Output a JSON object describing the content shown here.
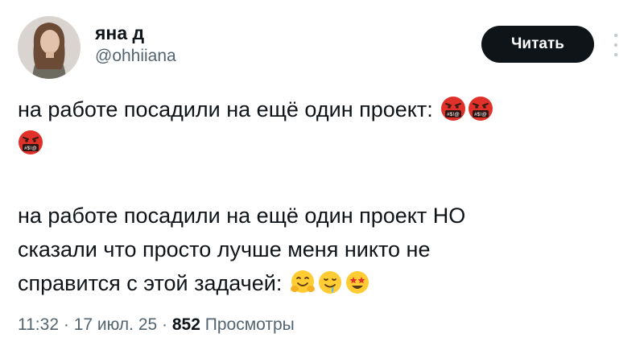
{
  "author": {
    "display_name": "яна д",
    "handle": "@ohhiiana"
  },
  "follow_button": {
    "label": "Читать"
  },
  "tweet": {
    "para1": {
      "line1": "на работе посадили на ещё один проект:",
      "emoji": [
        "face-with-symbols-on-mouth",
        "face-with-symbols-on-mouth",
        "face-with-symbols-on-mouth"
      ]
    },
    "para2": {
      "line1": "на работе посадили на ещё один проект НО",
      "line2": "сказали что просто лучше меня никто не",
      "line3": "справится с этой задачей:",
      "emoji": [
        "hugging-face",
        "drooling-face",
        "star-struck"
      ]
    }
  },
  "meta": {
    "time": "11:32",
    "date": "17 июл. 25",
    "views_count": "852",
    "views_label": "Просмотры",
    "separator": "·"
  },
  "colors": {
    "text": "#0f1419",
    "secondary": "#536471",
    "button_bg": "#0f1419",
    "button_text": "#ffffff",
    "angry_red": "#e0302a"
  },
  "icons": {
    "more": "more-vertical-icon"
  }
}
